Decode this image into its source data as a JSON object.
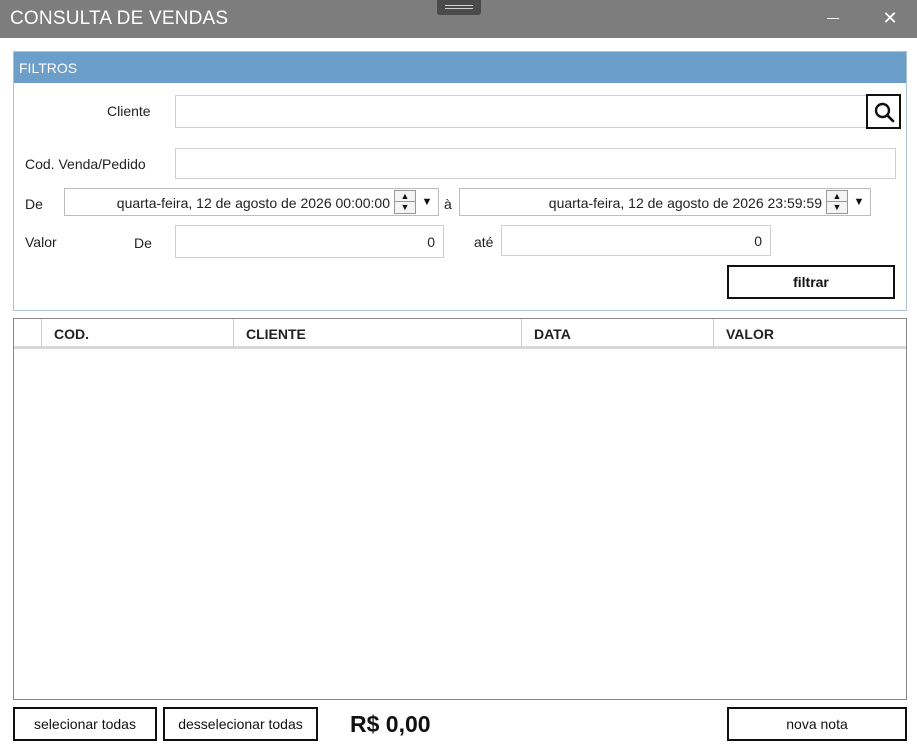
{
  "window": {
    "title": "CONSULTA DE VENDAS"
  },
  "filters": {
    "header": "FILTROS",
    "cliente_label": "Cliente",
    "cliente_value": "",
    "codigo_label": "Cod. Venda/Pedido",
    "codigo_value": "",
    "de_label": "De",
    "date_from": "quarta-feira, 12 de agosto de 2026 00:00:00",
    "a_label": "à",
    "date_to": "quarta-feira, 12 de agosto de 2026 23:59:59",
    "valor_label": "Valor",
    "valor_de_label": "De",
    "valor_de_value": "0",
    "ate_label": "até",
    "valor_ate_value": "0",
    "filtrar_label": "filtrar"
  },
  "grid": {
    "columns": [
      "COD.",
      "CLIENTE",
      "DATA",
      "VALOR"
    ],
    "rows": []
  },
  "footer": {
    "select_all_label": "selecionar todas",
    "deselect_all_label": "desselecionar todas",
    "total": "R$ 0,00",
    "new_note_label": "nova nota"
  },
  "icons": {
    "search": "search-icon",
    "minimize": "minimize-icon",
    "close": "close-icon",
    "spin": "spin-arrows-icon",
    "dropdown": "chevron-down-icon"
  },
  "colors": {
    "titlebar": "#7d7d7d",
    "filters_header": "#6b9ec8"
  }
}
